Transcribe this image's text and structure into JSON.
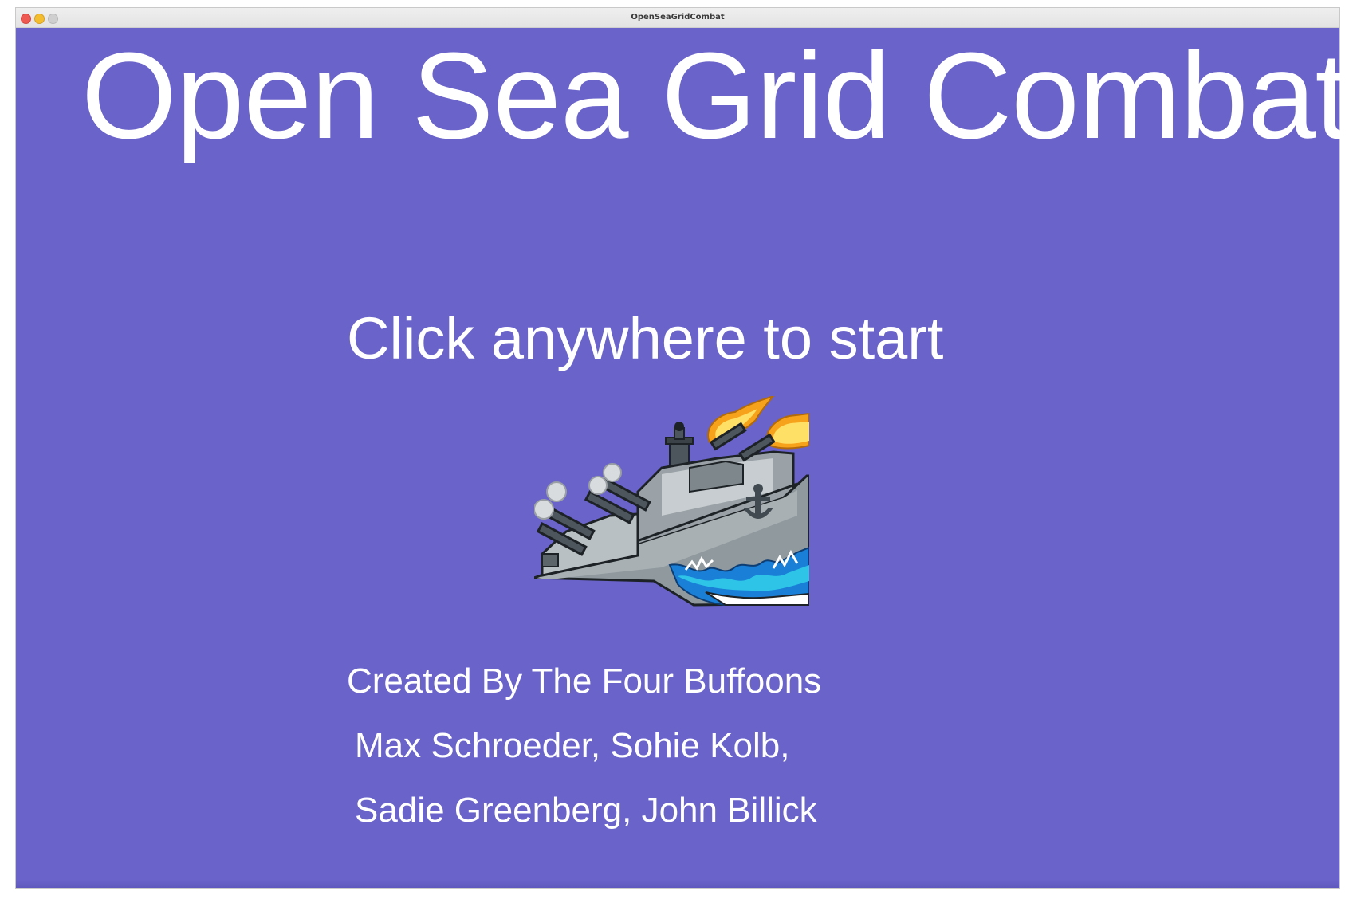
{
  "window": {
    "title": "OpenSeaGridCombat"
  },
  "screen": {
    "game_title": "Open Sea Grid Combat",
    "start_prompt": "Click anywhere to start",
    "credits": [
      "Created By The Four Buffoons",
      "Max Schroeder, Sohie Kolb,",
      "Sadie Greenberg, John Billick"
    ],
    "illustration": "battleship-icon"
  },
  "colors": {
    "background": "#6a63c9",
    "text": "#ffffff",
    "close": "#ee5a52",
    "minimize": "#f4bd2f",
    "maximize": "#cfcfcf"
  }
}
